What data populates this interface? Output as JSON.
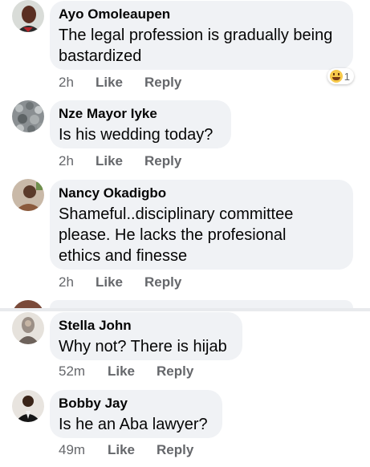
{
  "comments": [
    {
      "author": "Ayo Omoleaupen",
      "lines": [
        "The legal profession is gradually being",
        "bastardized"
      ],
      "time": "2h",
      "like": "Like",
      "reply": "Reply",
      "reaction": {
        "icon": "laughing-emoji-icon",
        "count": "1"
      }
    },
    {
      "author": "Nze Mayor Iyke",
      "lines": [
        "Is his wedding today?"
      ],
      "time": "2h",
      "like": "Like",
      "reply": "Reply"
    },
    {
      "author": "Nancy Okadigbo",
      "lines": [
        "Shameful..disciplinary committee",
        "please. He lacks the profesional",
        "ethics and finesse"
      ],
      "time": "2h",
      "like": "Like",
      "reply": "Reply"
    },
    {
      "author": "Stella John",
      "lines": [
        "Why not? There is hijab"
      ],
      "time": "52m",
      "like": "Like",
      "reply": "Reply"
    },
    {
      "author": "Bobby Jay",
      "lines": [
        "Is he an Aba lawyer?"
      ],
      "time": "49m",
      "like": "Like",
      "reply": "Reply"
    }
  ],
  "colors": {
    "bubble": "#f0f2f5",
    "text": "#050505",
    "meta": "#65676b"
  }
}
